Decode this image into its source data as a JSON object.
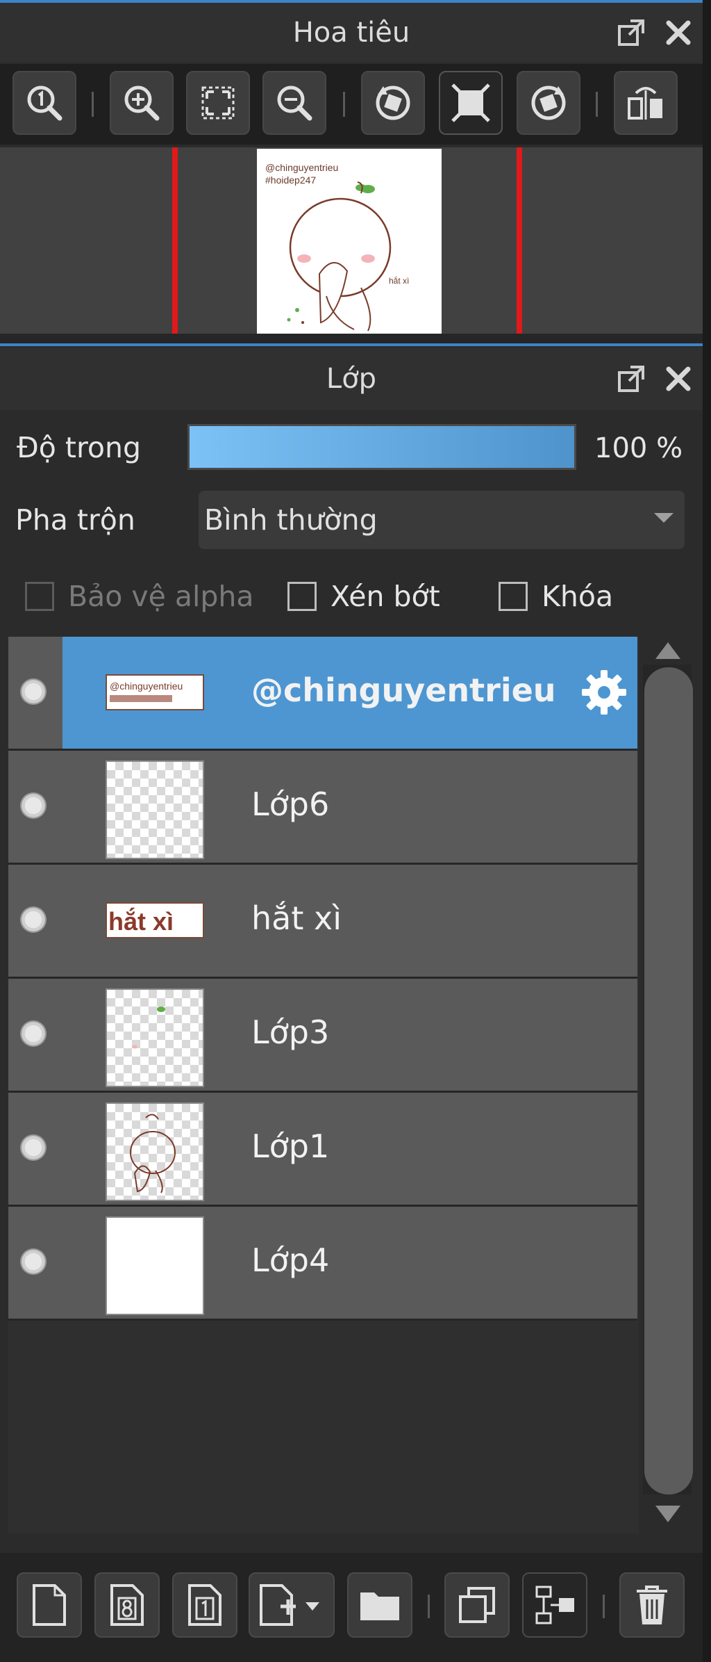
{
  "navigator": {
    "title": "Hoa tiêu",
    "preview_text_line1": "@chinguyentrieu",
    "preview_text_line2": "#hoidep247",
    "preview_caption": "hắt xì"
  },
  "layers_panel": {
    "title": "Lớp",
    "opacity_label": "Độ trong",
    "opacity_value": "100 %",
    "opacity_fraction": 1.0,
    "blend_label": "Pha trộn",
    "blend_value": "Bình thường",
    "checkboxes": {
      "protect_alpha": "Bảo vệ alpha",
      "clipping": "Xén bớt",
      "lock": "Khóa"
    },
    "layers": [
      {
        "name": "@chinguyentrieu",
        "selected": true,
        "thumb": "text"
      },
      {
        "name": "Lớp6",
        "selected": false,
        "thumb": "transparent"
      },
      {
        "name": "hắt xì",
        "selected": false,
        "thumb": "text"
      },
      {
        "name": "Lớp3",
        "selected": false,
        "thumb": "transparent"
      },
      {
        "name": "Lớp1",
        "selected": false,
        "thumb": "transparent"
      },
      {
        "name": "Lớp4",
        "selected": false,
        "thumb": "white"
      }
    ],
    "thumb_text_1": "@chinguyentrieu",
    "thumb_text_2": "hắt xì"
  },
  "colors": {
    "accent": "#3c84c8",
    "selected_row": "#4d96d2",
    "row": "#5a5a5a",
    "marker": "#e0191b"
  },
  "icons": {
    "navigator_toolbar": [
      "zoom-actual-icon",
      "zoom-in-icon",
      "fit-screen-icon",
      "zoom-out-icon",
      "rotate-left-icon",
      "fit-canvas-icon",
      "rotate-right-icon",
      "flip-horizontal-icon"
    ],
    "bottom_toolbar": [
      "new-layer-icon",
      "new-8bit-layer-icon",
      "new-1bit-layer-icon",
      "add-layer-menu-icon",
      "new-folder-icon",
      "duplicate-layer-icon",
      "merge-down-icon",
      "delete-layer-icon"
    ]
  }
}
